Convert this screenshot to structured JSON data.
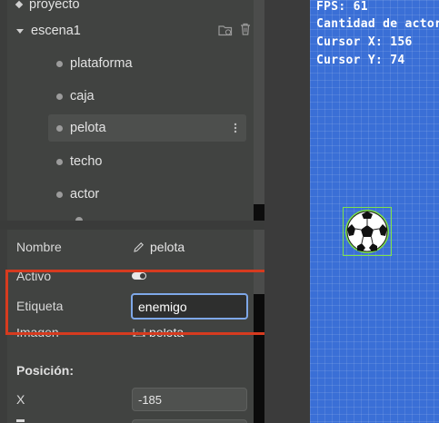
{
  "tree": {
    "project": "proyecto",
    "scene": "escena1",
    "items": [
      "plataforma",
      "caja",
      "pelota",
      "techo",
      "actor"
    ]
  },
  "properties": {
    "name_label": "Nombre",
    "name_value": "pelota",
    "active_label": "Activo",
    "active_value": true,
    "tag_label": "Etiqueta",
    "tag_value": "enemigo",
    "image_label": "Imagen",
    "image_value": "pelota",
    "position_heading": "Posición:",
    "x_label": "X",
    "x_value": "-185"
  },
  "hud": {
    "fps": "FPS: 61",
    "actors": "Cantidad de actores",
    "cursor_x": "Cursor X: 156",
    "cursor_y": "Cursor Y: 74"
  },
  "colors": {
    "game_bg": "#3a6fd6",
    "highlight": "#d63b1f",
    "input_focus_border": "#7ea7e8"
  }
}
